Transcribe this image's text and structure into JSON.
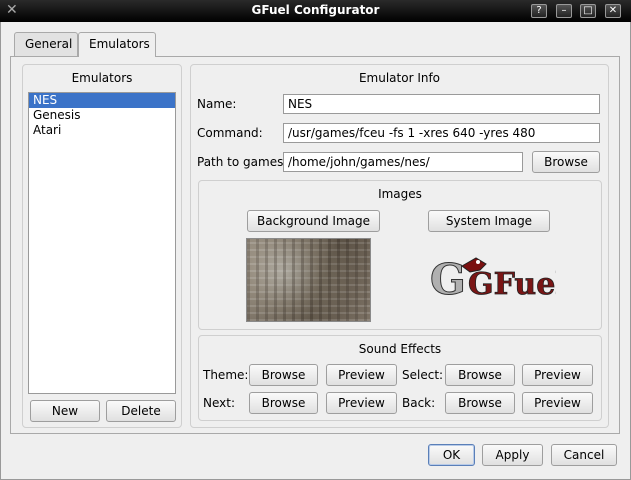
{
  "window": {
    "title": "GFuel Configurator",
    "buttons": {
      "help": "?",
      "minimize": "–",
      "maximize": "□",
      "close": "✕"
    }
  },
  "tabs": [
    {
      "label": "General",
      "active": false
    },
    {
      "label": "Emulators",
      "active": true
    }
  ],
  "emulators": {
    "title": "Emulators",
    "items": [
      "NES",
      "Genesis",
      "Atari"
    ],
    "selected": "NES",
    "new_label": "New",
    "delete_label": "Delete"
  },
  "info": {
    "title": "Emulator Info",
    "name_label": "Name:",
    "name_value": "NES",
    "command_label": "Command:",
    "command_value": "/usr/games/fceu -fs 1 -xres 640 -yres 480",
    "path_label": "Path to games:",
    "path_value": "/home/john/games/nes/",
    "browse_label": "Browse"
  },
  "images": {
    "title": "Images",
    "background_label": "Background Image",
    "system_label": "System Image",
    "logo_text": "GFuel"
  },
  "sound": {
    "title": "Sound Effects",
    "theme_label": "Theme:",
    "select_label": "Select:",
    "next_label": "Next:",
    "back_label": "Back:",
    "browse_label": "Browse",
    "preview_label": "Preview"
  },
  "footer": {
    "ok_label": "OK",
    "apply_label": "Apply",
    "cancel_label": "Cancel"
  }
}
